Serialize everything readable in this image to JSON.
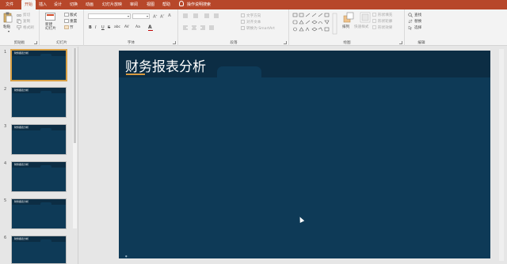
{
  "tabs": [
    {
      "label": "文件",
      "active": false
    },
    {
      "label": "开始",
      "active": true
    },
    {
      "label": "插入",
      "active": false
    },
    {
      "label": "设计",
      "active": false
    },
    {
      "label": "切换",
      "active": false
    },
    {
      "label": "动画",
      "active": false
    },
    {
      "label": "幻灯片放映",
      "active": false
    },
    {
      "label": "审阅",
      "active": false
    },
    {
      "label": "视图",
      "active": false
    },
    {
      "label": "帮助",
      "active": false
    }
  ],
  "tell_me": "操作说明搜索",
  "ribbon": {
    "clipboard": {
      "label": "剪贴板",
      "paste": "粘贴",
      "cut": "剪切",
      "copy": "复制",
      "format_painter": "格式刷"
    },
    "slides": {
      "label": "幻灯片",
      "new_slide": "新建\n幻灯片",
      "layout": "版式",
      "reset": "重置",
      "section": "节"
    },
    "font": {
      "label": "字体",
      "font_name": "",
      "font_size": "",
      "bold": "B",
      "italic": "I",
      "underline": "U",
      "strike": "S",
      "shadow": "abc",
      "spacing": "AV",
      "case": "Aa"
    },
    "paragraph": {
      "label": "段落",
      "text_direction": "文字方向",
      "align_text": "对齐文本",
      "smartart": "转换为 SmartArt"
    },
    "drawing": {
      "label": "绘图",
      "arrange": "排列",
      "quick_styles": "快速样式",
      "shape_fill": "形状填充",
      "shape_outline": "形状轮廓",
      "shape_effects": "形状效果"
    },
    "editing": {
      "label": "编辑",
      "find": "查找",
      "replace": "替换",
      "select": "选择"
    }
  },
  "thumbnails": [
    {
      "number": "1",
      "title": "财务报表分析",
      "selected": true
    },
    {
      "number": "2",
      "title": "财务报表分析",
      "selected": false
    },
    {
      "number": "3",
      "title": "财务报表分析",
      "selected": false
    },
    {
      "number": "4",
      "title": "财务报表分析",
      "selected": false
    },
    {
      "number": "5",
      "title": "财务报表分析",
      "selected": false
    },
    {
      "number": "6",
      "title": "财务报表分析",
      "selected": false
    }
  ],
  "slide": {
    "title": "财务报表分析",
    "footer": "● ·"
  },
  "colors": {
    "accent": "#b7472a",
    "slide_bg": "#0e3a57",
    "slide_header": "#0c2d44",
    "underline": "#d89a3f"
  }
}
